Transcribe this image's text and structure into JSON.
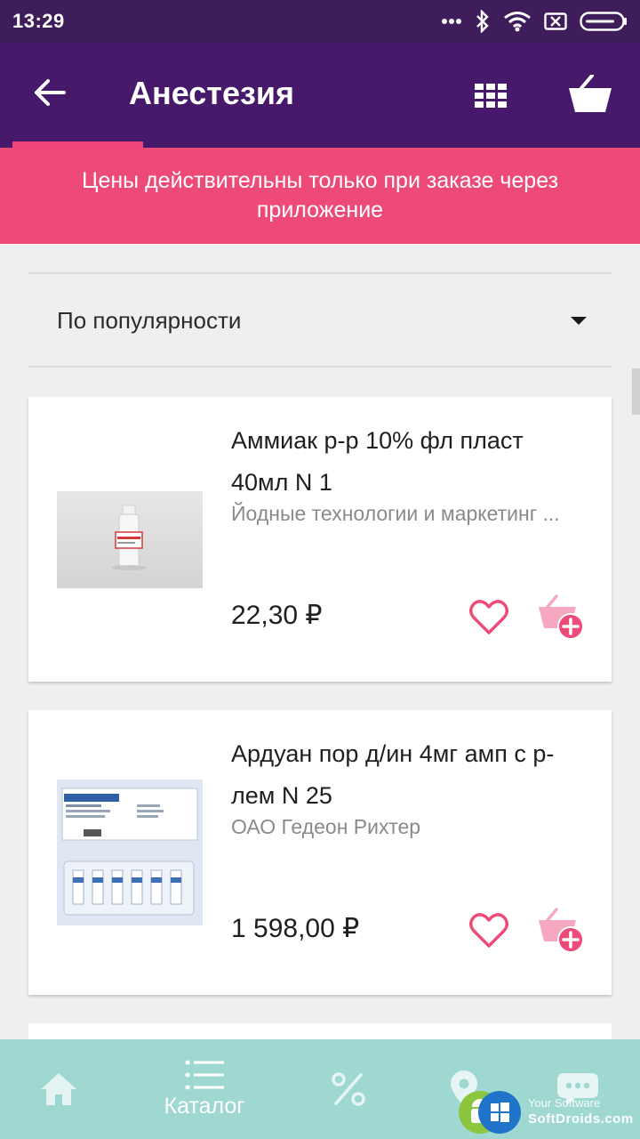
{
  "status_bar": {
    "time": "13:29"
  },
  "header": {
    "title": "Анестезия"
  },
  "banner": {
    "text": "Цены действительны только при заказе через приложение"
  },
  "sort": {
    "selected": "По популярности"
  },
  "products": [
    {
      "name": "Аммиак р-р 10% фл пласт 40мл N 1",
      "manufacturer": "Йодные технологии и маркетинг ...",
      "price": "22,30 ₽"
    },
    {
      "name": "Ардуан пор д/ин 4мг амп с р-лем N 25",
      "manufacturer": "ОАО Гедеон Рихтер",
      "price": "1 598,00 ₽"
    }
  ],
  "bottom_nav": {
    "catalog_label": "Каталог"
  },
  "watermark": {
    "line1": "Your Software",
    "line2": "SoftDroids.com"
  },
  "colors": {
    "status_bar": "#3f1d5a",
    "app_bar": "#46196a",
    "accent_pink": "#ee4a78",
    "bottom_nav": "#9ed8d0"
  }
}
